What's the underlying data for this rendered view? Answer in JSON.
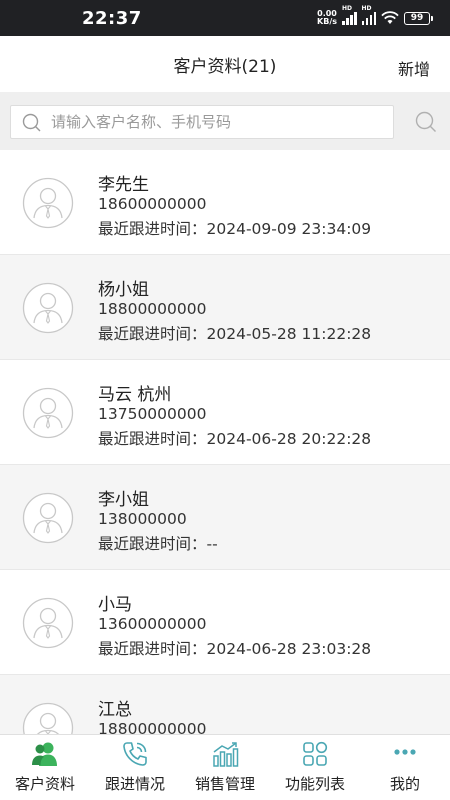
{
  "status_bar": {
    "time": "22:37",
    "net_speed_value": "0.00",
    "net_speed_unit": "KB/s",
    "hd1": "HD",
    "hd2": "HD",
    "battery": "99"
  },
  "header": {
    "title": "客户资料(21)",
    "add_label": "新增"
  },
  "search": {
    "placeholder": "请输入客户名称、手机号码"
  },
  "follow_prefix": "最近跟进时间：",
  "customers": [
    {
      "name": "李先生",
      "phone": "18600000000",
      "last_follow": "2024-09-09 23:34:09"
    },
    {
      "name": "杨小姐",
      "phone": "18800000000",
      "last_follow": "2024-05-28 11:22:28"
    },
    {
      "name": "马云 杭州",
      "phone": "13750000000",
      "last_follow": "2024-06-28 20:22:28"
    },
    {
      "name": "李小姐",
      "phone": "138000000",
      "last_follow": "--"
    },
    {
      "name": "小马",
      "phone": "13600000000",
      "last_follow": "2024-06-28 23:03:28"
    },
    {
      "name": "江总",
      "phone": "18800000000",
      "last_follow": ""
    }
  ],
  "tabs": [
    {
      "label": "客户资料",
      "icon": "customer-icon",
      "active": true
    },
    {
      "label": "跟进情况",
      "icon": "phone-icon",
      "active": false
    },
    {
      "label": "销售管理",
      "icon": "bar-chart-icon",
      "active": false
    },
    {
      "label": "功能列表",
      "icon": "grid-icon",
      "active": false
    },
    {
      "label": "我的",
      "icon": "more-icon",
      "active": false
    }
  ],
  "colors": {
    "accent_green": "#3cb35c",
    "tab_icon_teal": "#4aa7b3",
    "avatar_gray": "#c8c8c8"
  }
}
